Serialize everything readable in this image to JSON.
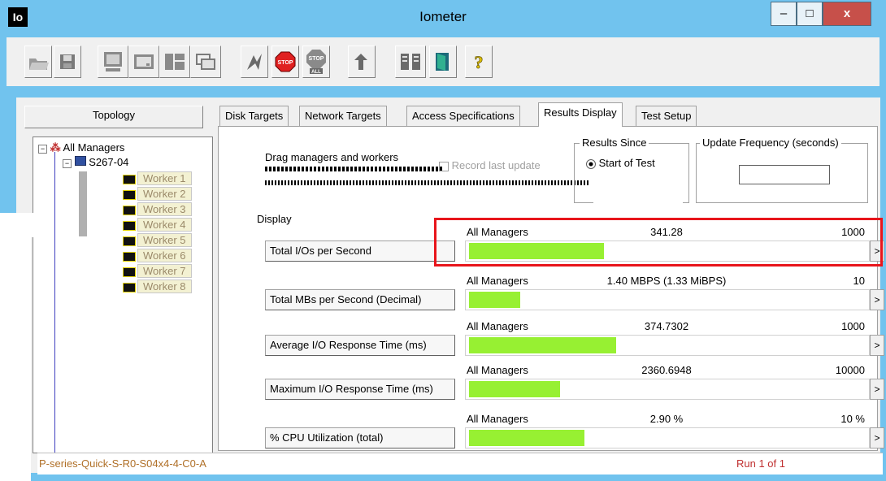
{
  "window": {
    "app_icon_text": "Io",
    "title": "Iometer",
    "minimize_glyph": "–",
    "maximize_glyph": "□",
    "close_glyph": "x"
  },
  "toolbar": {
    "buttons": [
      {
        "name": "open-icon"
      },
      {
        "name": "save-icon"
      },
      {
        "name": "new-disk-worker-icon"
      },
      {
        "name": "new-network-worker-icon"
      },
      {
        "name": "new-manager-icon"
      },
      {
        "name": "duplicate-worker-icon"
      },
      {
        "name": "start-tests-icon"
      },
      {
        "name": "stop-icon",
        "label": "STOP"
      },
      {
        "name": "stop-all-icon",
        "label": "STOP",
        "label2": "ALL"
      },
      {
        "name": "reset-workers-icon"
      },
      {
        "name": "disconnect-icon"
      },
      {
        "name": "exit-icon"
      },
      {
        "name": "help-icon",
        "label": "?"
      }
    ]
  },
  "topology": {
    "title": "Topology",
    "root": "All Managers",
    "manager": "S267-04",
    "workers": [
      "Worker 1",
      "Worker 2",
      "Worker 3",
      "Worker 4",
      "Worker 5",
      "Worker 6",
      "Worker 7",
      "Worker 8"
    ]
  },
  "tabs": [
    {
      "label": "Disk Targets"
    },
    {
      "label": "Network Targets"
    },
    {
      "label": "Access Specifications"
    },
    {
      "label": "Results Display"
    },
    {
      "label": "Test Setup"
    }
  ],
  "results": {
    "drag_text": "Drag managers and workers",
    "record_last_update": "Record last update",
    "results_since_label": "Results Since",
    "start_of_test": "Start of Test",
    "update_frequency_label": "Update Frequency (seconds)",
    "display_label": "Display",
    "metrics": [
      {
        "label": "Total I/Os per Second",
        "scope": "All Managers",
        "value": "341.28",
        "max": "1000",
        "fill": 0.34
      },
      {
        "label": "Total MBs per Second (Decimal)",
        "scope": "All Managers",
        "value": "1.40 MBPS (1.33 MiBPS)",
        "max": "10",
        "fill": 0.13
      },
      {
        "label": "Average I/O Response Time (ms)",
        "scope": "All Managers",
        "value": "374.7302",
        "max": "1000",
        "fill": 0.37
      },
      {
        "label": "Maximum I/O Response Time (ms)",
        "scope": "All Managers",
        "value": "2360.6948",
        "max": "10000",
        "fill": 0.23
      },
      {
        "label": "% CPU Utilization (total)",
        "scope": "All Managers",
        "value": "2.90 %",
        "max": "10 %",
        "fill": 0.29
      }
    ],
    "more_glyph": ">"
  },
  "status": {
    "left": "P-series-Quick-S-R0-S04x4-4-C0-A",
    "right": "Run 1 of 1"
  },
  "colors": {
    "titlebar": "#71c3ee",
    "bar_fill": "#97f032",
    "highlight_box": "#e8151b"
  }
}
